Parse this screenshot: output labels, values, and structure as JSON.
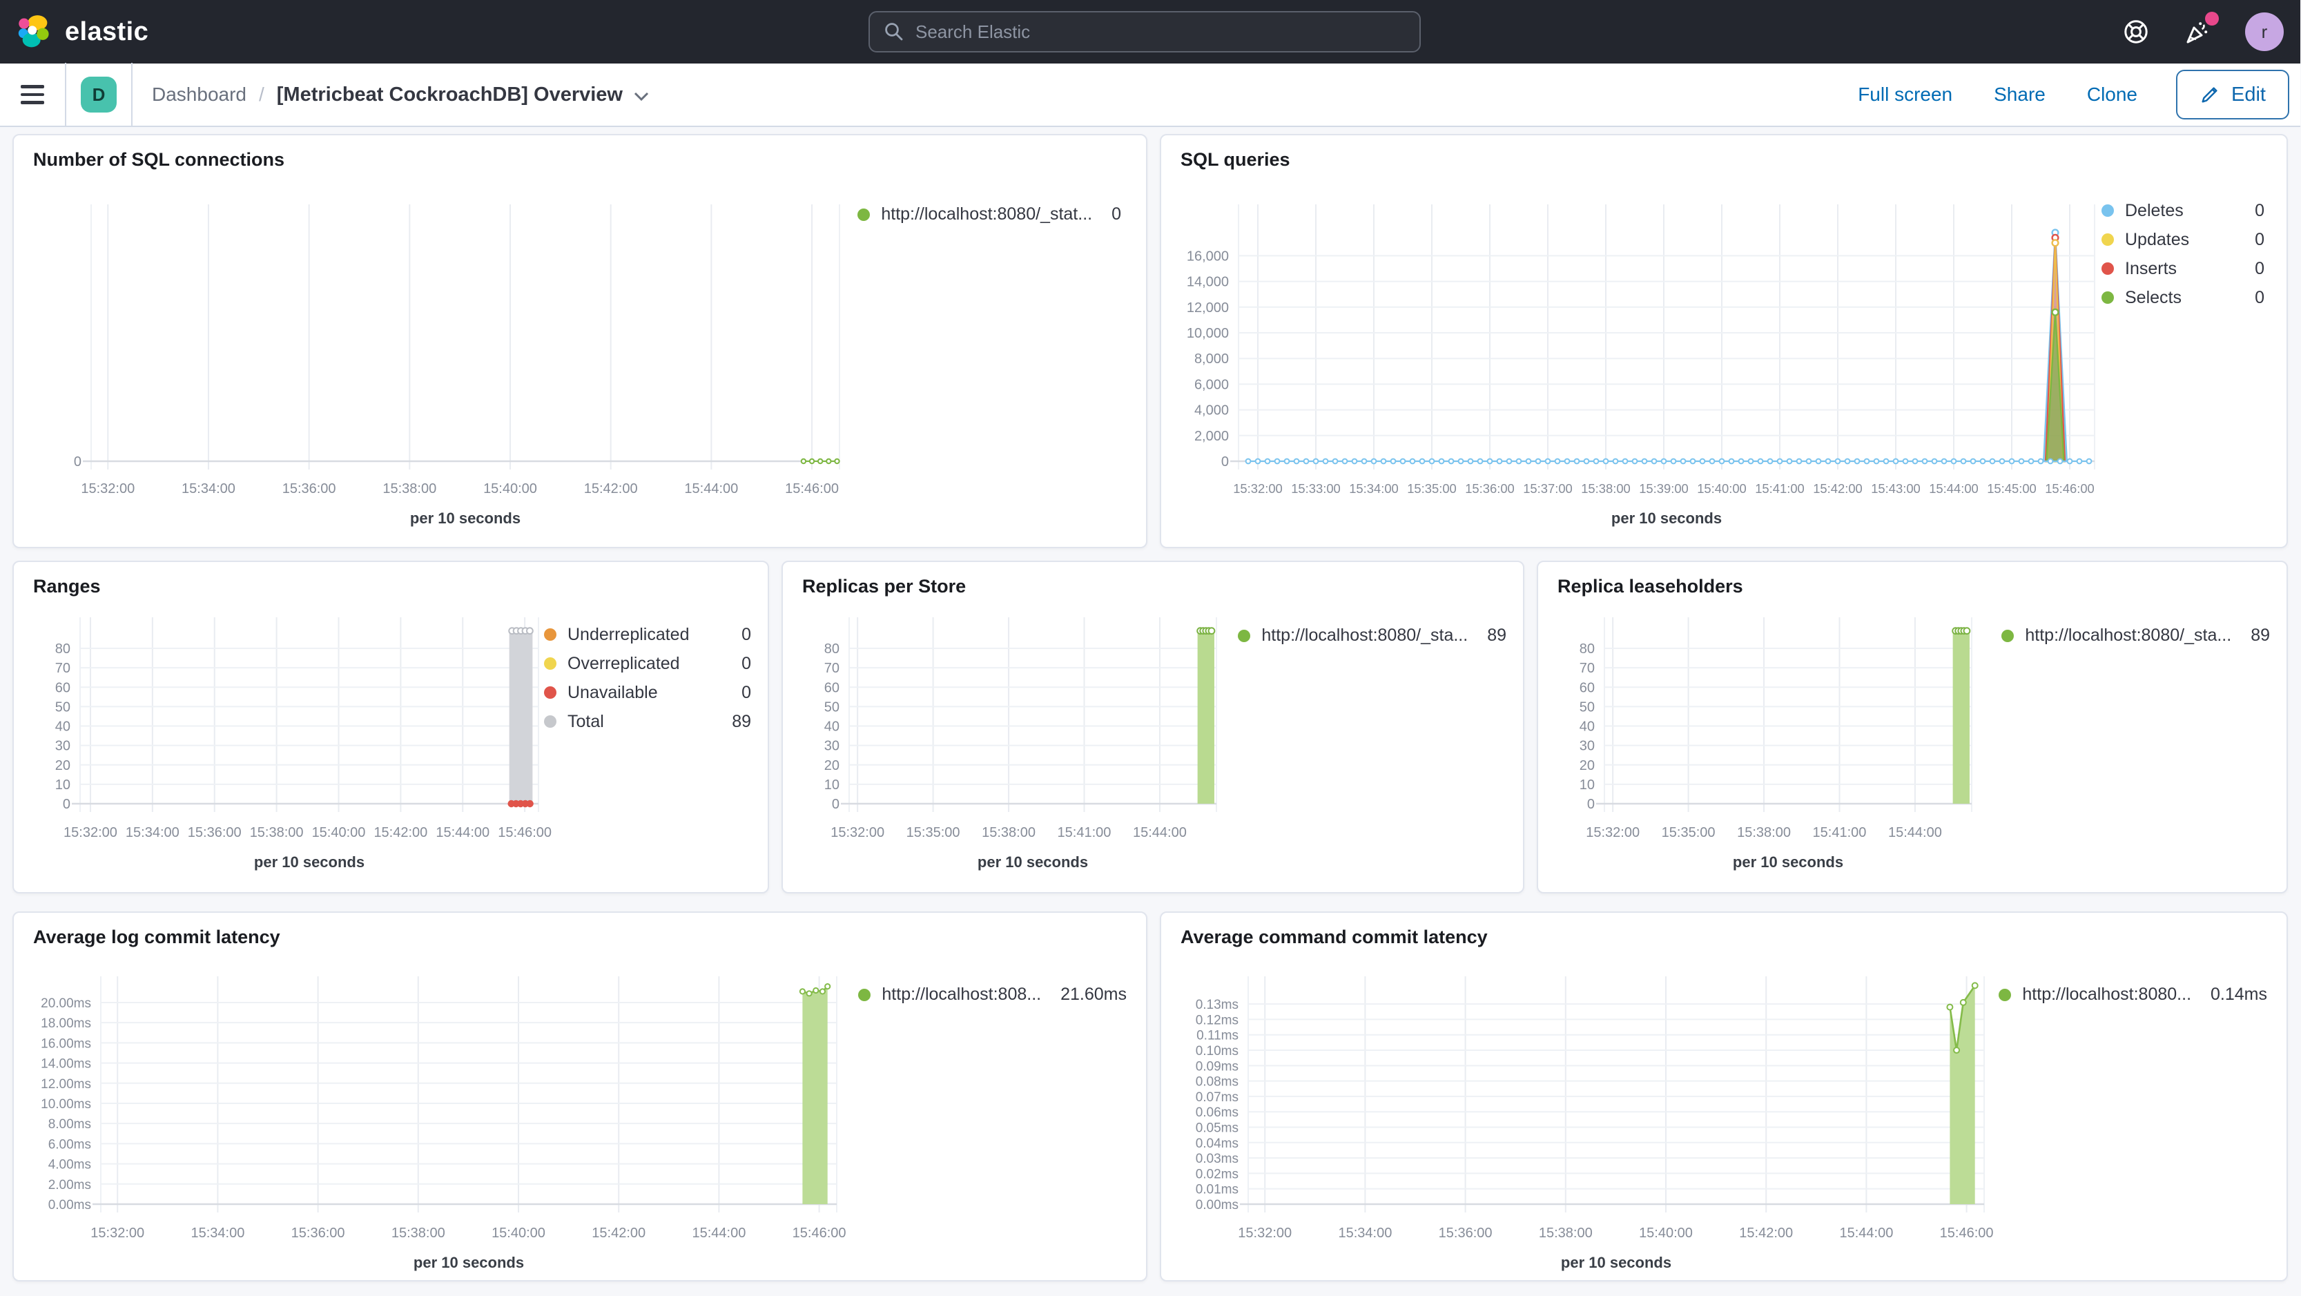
{
  "header": {
    "logo_text": "elastic",
    "search_placeholder": "Search Elastic",
    "avatar_initial": "r"
  },
  "breadcrumb": {
    "space_initial": "D",
    "section": "Dashboard",
    "separator": "/",
    "title": "[Metricbeat CockroachDB] Overview"
  },
  "actions": {
    "full_screen": "Full screen",
    "share": "Share",
    "clone": "Clone",
    "edit": "Edit"
  },
  "colors": {
    "green": "#7db742",
    "blue": "#79c3ee",
    "yellow": "#f0d54e",
    "red": "#e0544a",
    "orange": "#e8963c",
    "gray": "#c6c8cc",
    "link_blue": "#006bb4",
    "header_bg": "#23262e"
  },
  "chart_data": [
    {
      "id": "sqlconn",
      "title": "Number of SQL connections",
      "type": "line",
      "xlabel": "per 10 seconds",
      "x_range": [
        "15:31:40",
        "15:46:40"
      ],
      "ylim": [
        0,
        1
      ],
      "x_ticks": [
        "15:32:00",
        "15:34:00",
        "15:36:00",
        "15:38:00",
        "15:40:00",
        "15:42:00",
        "15:44:00",
        "15:46:00"
      ],
      "y_ticks": [
        {
          "v": 0,
          "label": "0"
        }
      ],
      "grid": {
        "vertical": true,
        "horizontal": false
      },
      "legend_position": "row",
      "legend": [
        {
          "label": "http://localhost:8080/_stat...",
          "value": "0",
          "color": "#7db742"
        }
      ],
      "series": [
        {
          "name": "sql-connections",
          "kind": "dotline",
          "color": "#7db742",
          "const": 0,
          "from": "15:45:50",
          "to": "15:46:30",
          "step": 10,
          "r": 1.6
        }
      ]
    },
    {
      "id": "sqlq",
      "title": "SQL queries",
      "type": "area",
      "xlabel": "per 10 seconds",
      "x_range": [
        "15:31:40",
        "15:46:30"
      ],
      "ylim": [
        0,
        20000
      ],
      "x_ticks": [
        "15:32:00",
        "15:33:00",
        "15:34:00",
        "15:35:00",
        "15:36:00",
        "15:37:00",
        "15:38:00",
        "15:39:00",
        "15:40:00",
        "15:41:00",
        "15:42:00",
        "15:43:00",
        "15:44:00",
        "15:45:00",
        "15:46:00"
      ],
      "y_ticks": [
        {
          "v": 0,
          "label": "0"
        },
        {
          "v": 2000,
          "label": "2,000"
        },
        {
          "v": 4000,
          "label": "4,000"
        },
        {
          "v": 6000,
          "label": "6,000"
        },
        {
          "v": 8000,
          "label": "8,000"
        },
        {
          "v": 10000,
          "label": "10,000"
        },
        {
          "v": 12000,
          "label": "12,000"
        },
        {
          "v": 14000,
          "label": "14,000"
        },
        {
          "v": 16000,
          "label": "16,000"
        }
      ],
      "grid": {
        "vertical": true,
        "horizontal": true
      },
      "legend_position": "column",
      "legend": [
        {
          "label": "Deletes",
          "value": "0",
          "color": "#79c3ee"
        },
        {
          "label": "Updates",
          "value": "0",
          "color": "#f0d54e"
        },
        {
          "label": "Inserts",
          "value": "0",
          "color": "#e0544a"
        },
        {
          "label": "Selects",
          "value": "0",
          "color": "#7db742"
        }
      ],
      "series": [
        {
          "name": "Deletes-spike",
          "kind": "spike",
          "color": "#79c3ee",
          "fill": "rgba(121,195,238,0.35)",
          "points": [
            [
              "15:45:33",
              0
            ],
            [
              "15:45:45",
              17800
            ],
            [
              "15:45:57",
              0
            ]
          ]
        },
        {
          "name": "Inserts-spike",
          "kind": "spike",
          "color": "#e0544a",
          "fill": "rgba(224,84,74,0.5)",
          "points": [
            [
              "15:45:35",
              0
            ],
            [
              "15:45:45",
              17400
            ],
            [
              "15:45:55",
              0
            ]
          ]
        },
        {
          "name": "Updates-spike",
          "kind": "spike",
          "color": "#edbd4d",
          "fill": "none",
          "points": [
            [
              "15:45:37",
              0
            ],
            [
              "15:45:45",
              17000
            ],
            [
              "15:45:53",
              0
            ]
          ]
        },
        {
          "name": "Selects-spike",
          "kind": "spike",
          "color": "#7db742",
          "fill": "rgba(125,183,66,0.65)",
          "points": [
            [
              "15:45:36",
              0
            ],
            [
              "15:45:45",
              11600
            ],
            [
              "15:45:54",
              0
            ]
          ]
        },
        {
          "name": "Deletes-baseline",
          "kind": "dotline",
          "color": "#79c3ee",
          "const": 0,
          "from": "15:31:50",
          "to": "15:46:20",
          "step": 10,
          "r": 1.7
        }
      ]
    },
    {
      "id": "ranges",
      "title": "Ranges",
      "type": "bar",
      "xlabel": "per 10 seconds",
      "x_range": [
        "15:31:40",
        "15:46:30"
      ],
      "ylim": [
        0,
        96
      ],
      "x_ticks": [
        "15:32:00",
        "15:34:00",
        "15:36:00",
        "15:38:00",
        "15:40:00",
        "15:42:00",
        "15:44:00",
        "15:46:00"
      ],
      "y_ticks": [
        {
          "v": 0,
          "label": "0"
        },
        {
          "v": 10,
          "label": "10"
        },
        {
          "v": 20,
          "label": "20"
        },
        {
          "v": 30,
          "label": "30"
        },
        {
          "v": 40,
          "label": "40"
        },
        {
          "v": 50,
          "label": "50"
        },
        {
          "v": 60,
          "label": "60"
        },
        {
          "v": 70,
          "label": "70"
        },
        {
          "v": 80,
          "label": "80"
        }
      ],
      "grid": {
        "vertical": true,
        "horizontal": true
      },
      "legend_position": "column",
      "legend": [
        {
          "label": "Underreplicated",
          "value": "0",
          "color": "#e8963c"
        },
        {
          "label": "Overreplicated",
          "value": "0",
          "color": "#f0d54e"
        },
        {
          "label": "Unavailable",
          "value": "0",
          "color": "#e0544a"
        },
        {
          "label": "Total",
          "value": "89",
          "color": "#c6c8cc"
        }
      ],
      "series": [
        {
          "name": "Total",
          "kind": "bar",
          "color": "#d2d4d9",
          "x0": "15:45:30",
          "x1": "15:46:15",
          "v": 89,
          "topMarkers": 5,
          "markerColor": "#b9bcc3"
        },
        {
          "name": "Unavailable",
          "kind": "dotsCluster",
          "color": "#e0544a",
          "r": 2.6,
          "points": [
            [
              "15:45:34",
              0
            ],
            [
              "15:45:43",
              0
            ],
            [
              "15:45:52",
              0
            ],
            [
              "15:46:01",
              0
            ],
            [
              "15:46:10",
              0
            ]
          ]
        }
      ]
    },
    {
      "id": "replicas",
      "title": "Replicas per Store",
      "type": "bar",
      "xlabel": "per 10 seconds",
      "x_range": [
        "15:31:40",
        "15:46:20"
      ],
      "ylim": [
        0,
        96
      ],
      "x_ticks": [
        "15:32:00",
        "15:35:00",
        "15:38:00",
        "15:41:00",
        "15:44:00"
      ],
      "y_ticks": [
        {
          "v": 0,
          "label": "0"
        },
        {
          "v": 10,
          "label": "10"
        },
        {
          "v": 20,
          "label": "20"
        },
        {
          "v": 30,
          "label": "30"
        },
        {
          "v": 40,
          "label": "40"
        },
        {
          "v": 50,
          "label": "50"
        },
        {
          "v": 60,
          "label": "60"
        },
        {
          "v": 70,
          "label": "70"
        },
        {
          "v": 80,
          "label": "80"
        }
      ],
      "grid": {
        "vertical": true,
        "horizontal": true
      },
      "legend_position": "row",
      "legend": [
        {
          "label": "http://localhost:8080/_sta...",
          "value": "89",
          "color": "#7db742"
        }
      ],
      "series": [
        {
          "name": "replicas",
          "kind": "bar",
          "color": "#b9da90",
          "x0": "15:45:30",
          "x1": "15:46:10",
          "v": 89,
          "topMarkers": 5,
          "markerColor": "#7cb344"
        }
      ]
    },
    {
      "id": "lease",
      "title": "Replica leaseholders",
      "type": "bar",
      "xlabel": "per 10 seconds",
      "x_range": [
        "15:31:40",
        "15:46:20"
      ],
      "ylim": [
        0,
        96
      ],
      "x_ticks": [
        "15:32:00",
        "15:35:00",
        "15:38:00",
        "15:41:00",
        "15:44:00"
      ],
      "y_ticks": [
        {
          "v": 0,
          "label": "0"
        },
        {
          "v": 10,
          "label": "10"
        },
        {
          "v": 20,
          "label": "20"
        },
        {
          "v": 30,
          "label": "30"
        },
        {
          "v": 40,
          "label": "40"
        },
        {
          "v": 50,
          "label": "50"
        },
        {
          "v": 60,
          "label": "60"
        },
        {
          "v": 70,
          "label": "70"
        },
        {
          "v": 80,
          "label": "80"
        }
      ],
      "grid": {
        "vertical": true,
        "horizontal": true
      },
      "legend_position": "row",
      "legend": [
        {
          "label": "http://localhost:8080/_sta...",
          "value": "89",
          "color": "#7db742"
        }
      ],
      "series": [
        {
          "name": "leaseholders",
          "kind": "bar",
          "color": "#b9da90",
          "x0": "15:45:30",
          "x1": "15:46:10",
          "v": 89,
          "topMarkers": 5,
          "markerColor": "#7cb344"
        }
      ]
    },
    {
      "id": "loglat",
      "title": "Average log commit latency",
      "type": "area",
      "xlabel": "per 10 seconds",
      "x_range": [
        "15:31:40",
        "15:46:20"
      ],
      "ylim": [
        0,
        22.6
      ],
      "x_ticks": [
        "15:32:00",
        "15:34:00",
        "15:36:00",
        "15:38:00",
        "15:40:00",
        "15:42:00",
        "15:44:00",
        "15:46:00"
      ],
      "y_ticks": [
        {
          "v": 0,
          "label": "0.00ms"
        },
        {
          "v": 2,
          "label": "2.00ms"
        },
        {
          "v": 4,
          "label": "4.00ms"
        },
        {
          "v": 6,
          "label": "6.00ms"
        },
        {
          "v": 8,
          "label": "8.00ms"
        },
        {
          "v": 10,
          "label": "10.00ms"
        },
        {
          "v": 12,
          "label": "12.00ms"
        },
        {
          "v": 14,
          "label": "14.00ms"
        },
        {
          "v": 16,
          "label": "16.00ms"
        },
        {
          "v": 18,
          "label": "18.00ms"
        },
        {
          "v": 20,
          "label": "20.00ms"
        }
      ],
      "grid": {
        "vertical": true,
        "horizontal": true
      },
      "legend_position": "row",
      "legend": [
        {
          "label": "http://localhost:808...",
          "value": "21.60ms",
          "color": "#7db742"
        }
      ],
      "series": [
        {
          "name": "log-commit-latency-ms",
          "kind": "areaLine",
          "color": "#84bb4a",
          "fill": "#bcdc96",
          "r": 1.8,
          "points": [
            [
              "15:45:40",
              21.1
            ],
            [
              "15:45:48",
              20.9
            ],
            [
              "15:45:56",
              21.2
            ],
            [
              "15:46:04",
              21.1
            ],
            [
              "15:46:10",
              21.6
            ]
          ]
        }
      ]
    },
    {
      "id": "cmdlat",
      "title": "Average command commit latency",
      "type": "area",
      "xlabel": "per 10 seconds",
      "x_range": [
        "15:31:40",
        "15:46:20"
      ],
      "ylim": [
        0,
        0.148
      ],
      "x_ticks": [
        "15:32:00",
        "15:34:00",
        "15:36:00",
        "15:38:00",
        "15:40:00",
        "15:42:00",
        "15:44:00",
        "15:46:00"
      ],
      "y_ticks": [
        {
          "v": 0,
          "label": "0.00ms"
        },
        {
          "v": 0.01,
          "label": "0.01ms"
        },
        {
          "v": 0.02,
          "label": "0.02ms"
        },
        {
          "v": 0.03,
          "label": "0.03ms"
        },
        {
          "v": 0.04,
          "label": "0.04ms"
        },
        {
          "v": 0.05,
          "label": "0.05ms"
        },
        {
          "v": 0.06,
          "label": "0.06ms"
        },
        {
          "v": 0.07,
          "label": "0.07ms"
        },
        {
          "v": 0.08,
          "label": "0.08ms"
        },
        {
          "v": 0.09,
          "label": "0.09ms"
        },
        {
          "v": 0.1,
          "label": "0.10ms"
        },
        {
          "v": 0.11,
          "label": "0.11ms"
        },
        {
          "v": 0.12,
          "label": "0.12ms"
        },
        {
          "v": 0.13,
          "label": "0.13ms"
        }
      ],
      "grid": {
        "vertical": true,
        "horizontal": true
      },
      "legend_position": "row",
      "legend": [
        {
          "label": "http://localhost:8080...",
          "value": "0.14ms",
          "color": "#7db742"
        }
      ],
      "series": [
        {
          "name": "command-commit-latency-ms",
          "kind": "areaLine",
          "color": "#84bb4a",
          "fill": "#bcdc96",
          "r": 2,
          "points": [
            [
              "15:45:40",
              0.128
            ],
            [
              "15:45:48",
              0.1
            ],
            [
              "15:45:56",
              0.131
            ],
            [
              "15:46:10",
              0.142
            ]
          ]
        }
      ]
    }
  ]
}
